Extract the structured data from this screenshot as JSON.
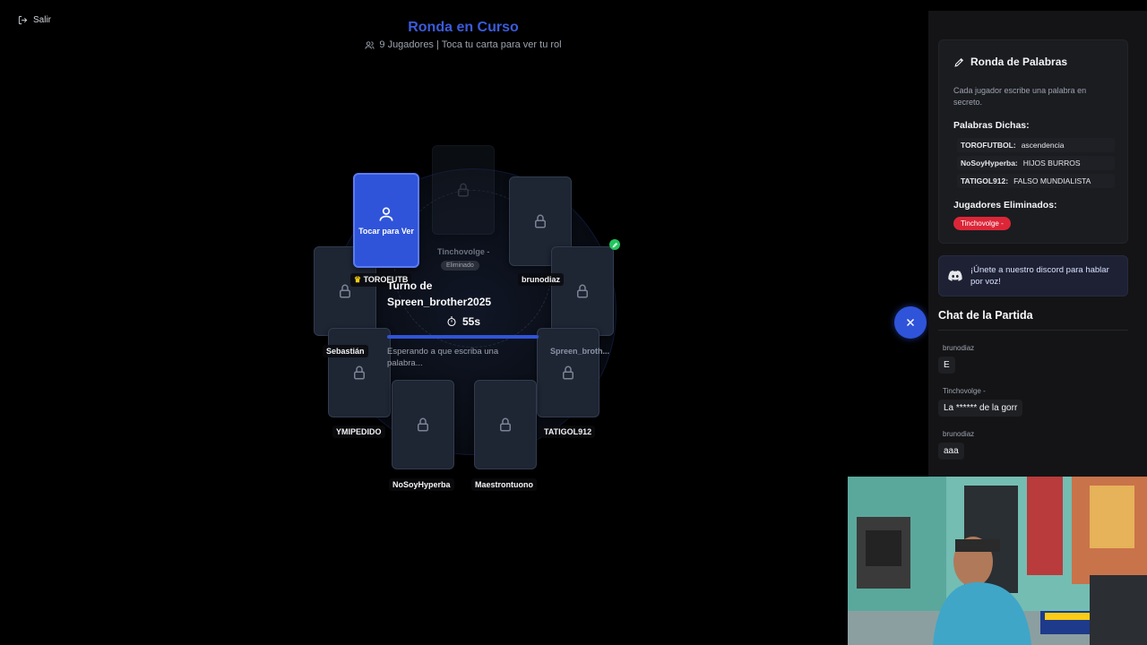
{
  "exit": {
    "label": "Salir"
  },
  "header": {
    "title": "Ronda en Curso",
    "subtitle": "9 Jugadores | Toca tu carta para ver tu rol"
  },
  "players": [
    {
      "name": "TOROFUTB",
      "state": "active",
      "crown": true
    },
    {
      "name": "Tinchovolge -",
      "state": "eliminated"
    },
    {
      "name": "brunodiaz",
      "state": "locked"
    },
    {
      "name": "Spreen_broth...",
      "state": "locked"
    },
    {
      "name": "TATIGOL912",
      "state": "locked"
    },
    {
      "name": "Maestrontuono",
      "state": "locked"
    },
    {
      "name": "NoSoyHyperba",
      "state": "locked"
    },
    {
      "name": "YMIPEDIDO",
      "state": "locked"
    },
    {
      "name": "Sebastián",
      "state": "locked"
    }
  ],
  "active_card": {
    "label": "Tocar para Ver"
  },
  "eliminated_badge": "Eliminado",
  "turn": {
    "line1": "Turno de",
    "player": "Spreen_brother2025",
    "timer": "55s",
    "progress": 0.98,
    "waiting": "Esperando a que escriba una palabra..."
  },
  "rounds_panel": {
    "title": "Ronda de Palabras",
    "description": "Cada jugador escribe una palabra en secreto.",
    "words_heading": "Palabras Dichas:",
    "words": [
      {
        "player": "TOROFUTBOL:",
        "word": "ascendencia"
      },
      {
        "player": "NoSoyHyperba:",
        "word": "HIJOS BURROS"
      },
      {
        "player": "TATIGOL912:",
        "word": "FALSO MUNDIALISTA"
      }
    ],
    "eliminated_heading": "Jugadores Eliminados:",
    "eliminated": [
      "Tinchovolge -"
    ]
  },
  "discord": {
    "label": "¡Únete a nuestro discord para hablar por voz!"
  },
  "chat": {
    "title": "Chat de la Partida",
    "messages": [
      {
        "user": "brunodiaz",
        "text": "E"
      },
      {
        "user": "Tinchovolge -",
        "text": "La ****** de la gorr"
      },
      {
        "user": "brunodiaz",
        "text": "aaa"
      }
    ]
  },
  "colors": {
    "accent": "#2f54d9",
    "title_blue": "#3b5bdb",
    "eliminated_red": "#dc2638",
    "online_green": "#22c55e"
  },
  "icons": {
    "exit": "logout-icon",
    "players": "users-icon",
    "lock": "lock-icon",
    "user": "user-icon",
    "timer": "stopwatch-icon",
    "pencil": "pencil-icon",
    "discord": "discord-icon",
    "toggle": "close-icon"
  }
}
